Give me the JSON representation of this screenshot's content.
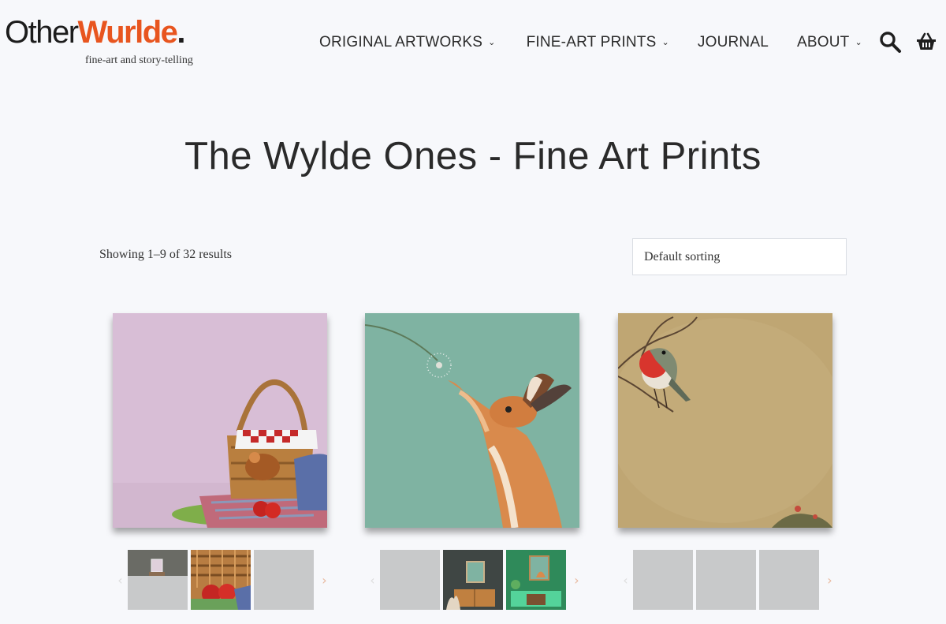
{
  "logo": {
    "part1": "Other",
    "part2": "Wurlde",
    "dot": ".",
    "tagline": "fine-art and story-telling"
  },
  "nav": {
    "items": [
      {
        "label": "ORIGINAL ARTWORKS",
        "has_dropdown": true
      },
      {
        "label": "FINE-ART PRINTS",
        "has_dropdown": true
      },
      {
        "label": "JOURNAL",
        "has_dropdown": false
      },
      {
        "label": "ABOUT",
        "has_dropdown": true
      }
    ],
    "chevron": "⌄",
    "search_icon": "search-icon",
    "basket_icon": "basket-icon"
  },
  "page": {
    "title": "The Wylde Ones - Fine Art Prints",
    "result_count": "Showing 1–9 of 32 results",
    "sort_selected": "Default sorting"
  },
  "products": [
    {
      "image": "picnic-basket-mouse",
      "bg": "#d8bed6"
    },
    {
      "image": "hare-dandelion",
      "bg": "#7fb3a2"
    },
    {
      "image": "robin-branch",
      "bg": "#bfa673"
    }
  ],
  "thumb_arrows": {
    "prev": "‹",
    "next": "›"
  },
  "colors": {
    "accent": "#e8551f",
    "background": "#f7f8fb",
    "thumb_placeholder": "#c8c9ca"
  }
}
